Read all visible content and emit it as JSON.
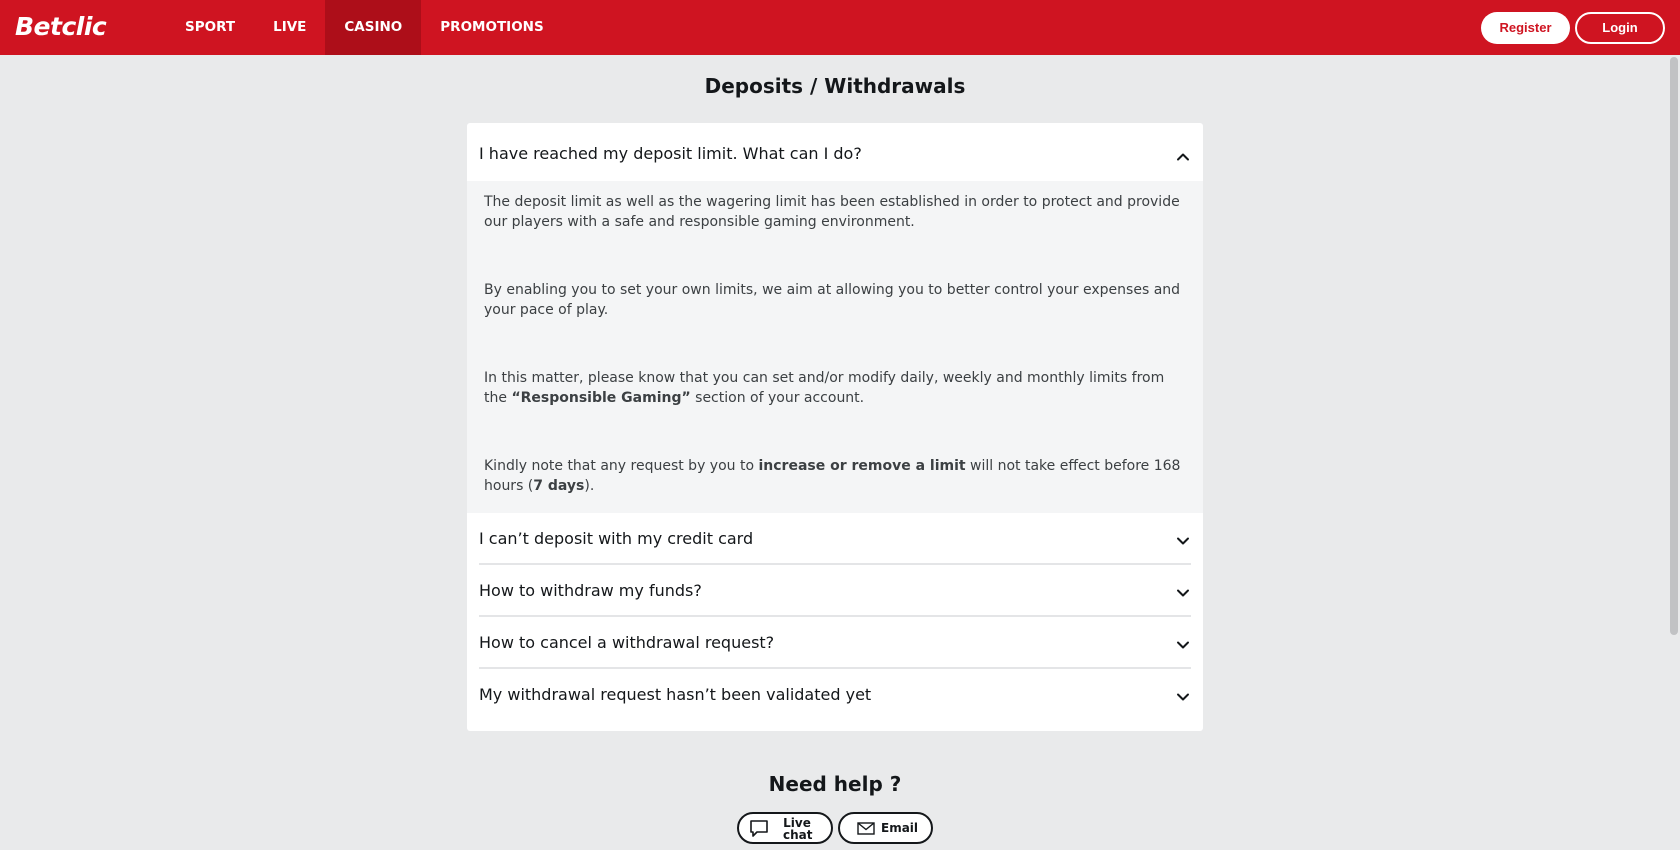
{
  "brand": {
    "logo": "Betclic",
    "color": "#cf1421",
    "active_nav_color": "#ad0e19"
  },
  "nav": {
    "items": [
      {
        "label": "SPORT",
        "active": false
      },
      {
        "label": "LIVE",
        "active": false
      },
      {
        "label": "CASINO",
        "active": true
      },
      {
        "label": "PROMOTIONS",
        "active": false
      }
    ]
  },
  "auth": {
    "register_label": "Register",
    "login_label": "Login"
  },
  "page": {
    "title": "Deposits / Withdrawals"
  },
  "faq": {
    "open_question": "I have reached my deposit limit. What can I do?",
    "answer": {
      "p1": "The deposit limit as well as the wagering limit has been established in order to protect and provide our players with a safe and responsible gaming environment.",
      "p2": "By enabling you to set your own limits, we aim at allowing you to better control your expenses and your pace of play.",
      "p3_before": "In this matter, please know that you can set and/or modify daily, weekly and monthly limits from the ",
      "p3_bold": "“Responsible Gaming”",
      "p3_after": " section of your account.",
      "p4_before": "Kindly note that any request by you to ",
      "p4_bold1": "increase or remove a limit",
      "p4_mid": " will not take effect before 168 hours (",
      "p4_bold2": "7 days",
      "p4_after": ")."
    },
    "questions": [
      "I can’t deposit with my credit card",
      "How to withdraw my funds?",
      "How to cancel a withdrawal request?",
      "My withdrawal request hasn’t been validated yet"
    ]
  },
  "help": {
    "title": "Need help ?",
    "live_chat_line1": "Live",
    "live_chat_line2": "chat",
    "email_label": "Email",
    "icons": [
      "chat-bubble-icon",
      "envelope-icon"
    ]
  }
}
